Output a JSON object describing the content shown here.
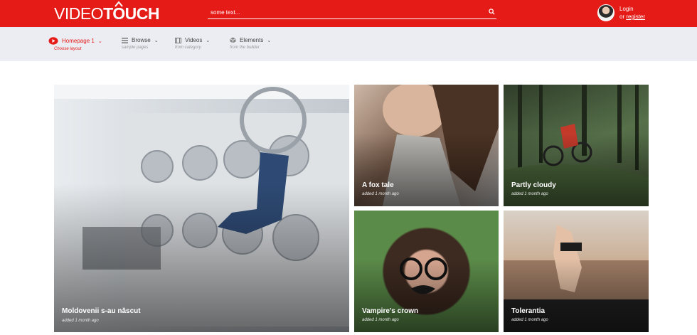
{
  "header": {
    "logo_thin": "VIDEO",
    "logo_bold": "TOUCH",
    "search_placeholder": "some text...",
    "login_label": "Login",
    "or_label": "or",
    "register_label": "register",
    "brand_color": "#e41b17"
  },
  "nav": {
    "items": [
      {
        "label": "Homepage 1",
        "sub": "Choose layout",
        "icon": "play-circle-icon",
        "active": true
      },
      {
        "label": "Browse",
        "sub": "sample pages",
        "icon": "list-icon",
        "active": false
      },
      {
        "label": "Videos",
        "sub": "from category",
        "icon": "film-icon",
        "active": false
      },
      {
        "label": "Elements",
        "sub": "from the builder",
        "icon": "cube-icon",
        "active": false
      }
    ]
  },
  "cards": [
    {
      "title": "Moldovenii s-au născut",
      "meta": "added 1 month ago"
    },
    {
      "title": "A fox tale",
      "meta": "added 1 month ago"
    },
    {
      "title": "Partly cloudy",
      "meta": "added 1 month ago"
    },
    {
      "title": "Vampire's crown",
      "meta": "added 1 month ago"
    },
    {
      "title": "Tolerantia",
      "meta": "added 1 month ago"
    }
  ]
}
